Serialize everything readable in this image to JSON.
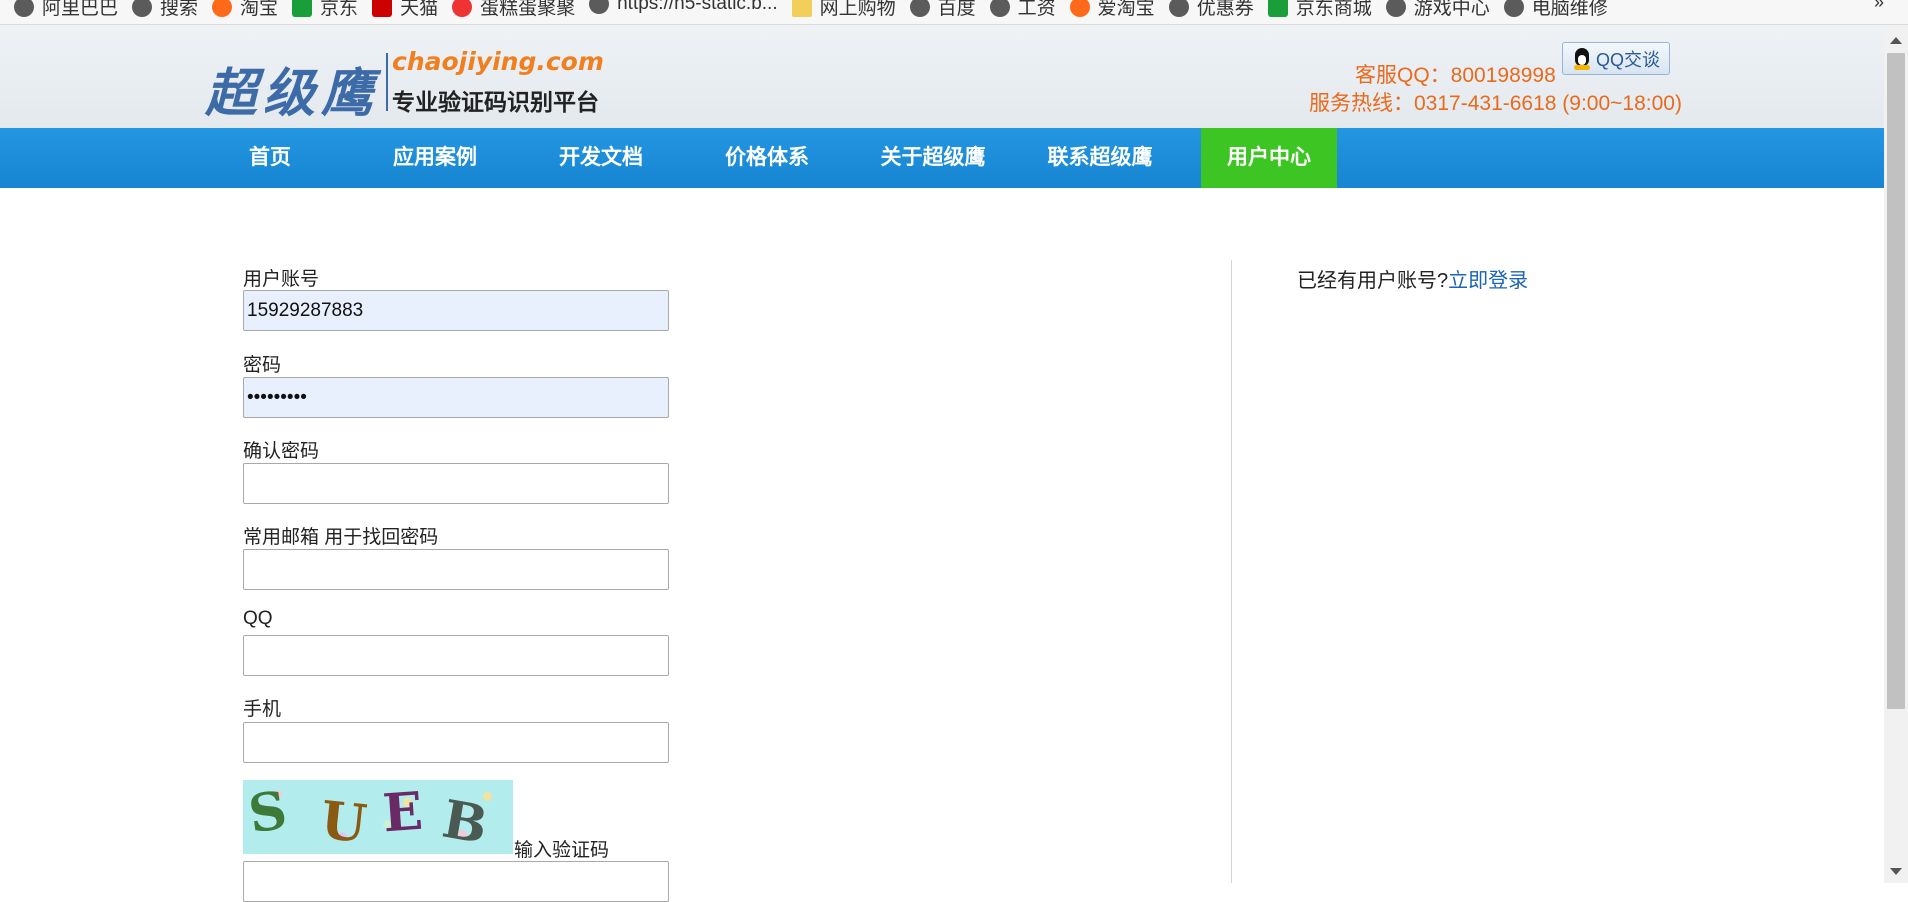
{
  "bookmarks": [
    {
      "label": "阿里巴巴",
      "icon": "globe-icon"
    },
    {
      "label": "搜索",
      "icon": "globe-icon"
    },
    {
      "label": "淘宝",
      "icon": "taobao-icon"
    },
    {
      "label": "京东",
      "icon": "jd-icon"
    },
    {
      "label": "天猫",
      "icon": "tmall-icon"
    },
    {
      "label": "蛋糕蛋聚聚",
      "icon": "red-icon"
    },
    {
      "label": "https://h5-static.b...",
      "icon": "globe-icon"
    },
    {
      "label": "网上购物",
      "icon": "folder-icon"
    },
    {
      "label": "百度",
      "icon": "globe-icon"
    },
    {
      "label": "工资",
      "icon": "globe-icon"
    },
    {
      "label": "爱淘宝",
      "icon": "taobao-icon"
    },
    {
      "label": "优惠券",
      "icon": "globe-icon"
    },
    {
      "label": "京东商城",
      "icon": "jd-icon"
    },
    {
      "label": "游戏中心",
      "icon": "globe-icon"
    },
    {
      "label": "电脑维修",
      "icon": "globe-icon"
    }
  ],
  "bookmarks_more": "»",
  "header": {
    "logo_cn": "超级鹰",
    "logo_en": "chaojiying.com",
    "logo_sub": "专业验证码识别平台",
    "service_qq": "客服QQ：800198998",
    "service_tel": "服务热线：0317-431-6618 (9:00~18:00)",
    "qq_button": "QQ交谈"
  },
  "nav": [
    {
      "label": "首页",
      "active": false
    },
    {
      "label": "应用案例",
      "active": false
    },
    {
      "label": "开发文档",
      "active": false
    },
    {
      "label": "价格体系",
      "active": false
    },
    {
      "label": "关于超级鹰",
      "active": false
    },
    {
      "label": "联系超级鹰",
      "active": false
    },
    {
      "label": "用户中心",
      "active": true
    }
  ],
  "form": {
    "username_label": "用户账号",
    "username_value": "15929287883",
    "password_label": "密码",
    "password_value": "•••••••••",
    "confirm_label": "确认密码",
    "confirm_value": "",
    "email_label": "常用邮箱 用于找回密码",
    "email_value": "",
    "qq_label": "QQ",
    "qq_value": "",
    "phone_label": "手机",
    "phone_value": "",
    "captcha_text": [
      "S",
      "U",
      "E",
      "B"
    ],
    "captcha_label": "输入验证码",
    "captcha_value": ""
  },
  "login": {
    "hint": "已经有用户账号?",
    "link": "立即登录"
  },
  "colors": {
    "nav_bg": "#1a89d6",
    "nav_active": "#3dc623",
    "accent_orange": "#ea6a1c",
    "link_blue": "#1a63b5",
    "autofill_bg": "#e8f0fe"
  }
}
